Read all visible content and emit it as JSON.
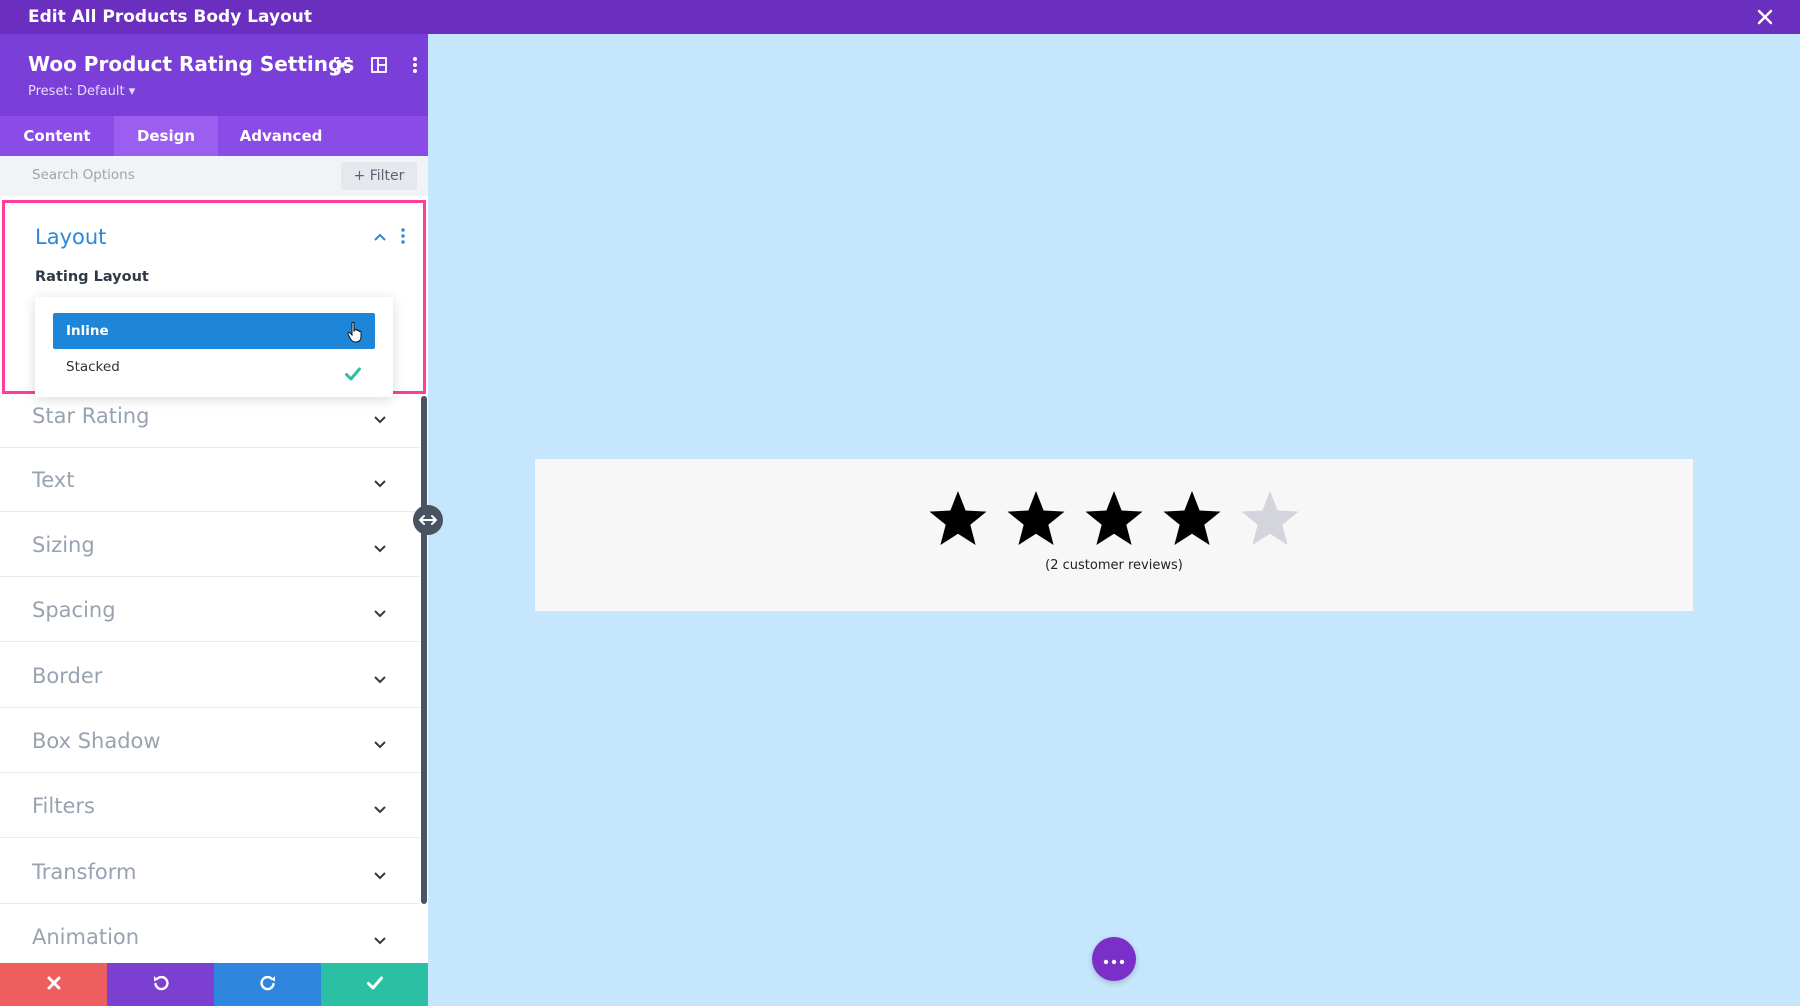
{
  "window": {
    "title": "Edit All Products Body Layout"
  },
  "panel": {
    "title": "Woo Product Rating Settings",
    "preset": "Preset: Default",
    "tabs": [
      {
        "label": "Content"
      },
      {
        "label": "Design",
        "active": true
      },
      {
        "label": "Advanced"
      }
    ],
    "search_placeholder": "Search Options",
    "filter_label": "+ Filter",
    "layout": {
      "title": "Layout",
      "field_label": "Rating Layout",
      "options": [
        {
          "label": "Inline",
          "highlighted": true
        },
        {
          "label": "Stacked",
          "checked": true
        }
      ]
    },
    "sections": [
      {
        "label": "Star Rating"
      },
      {
        "label": "Text"
      },
      {
        "label": "Sizing"
      },
      {
        "label": "Spacing"
      },
      {
        "label": "Border"
      },
      {
        "label": "Box Shadow"
      },
      {
        "label": "Filters"
      },
      {
        "label": "Transform"
      },
      {
        "label": "Animation"
      }
    ],
    "bottom_buttons": [
      {
        "name": "discard",
        "icon": "close-icon",
        "color": "#ee5e5e"
      },
      {
        "name": "undo",
        "icon": "undo-icon",
        "color": "#7b3fd1"
      },
      {
        "name": "redo",
        "icon": "redo-icon",
        "color": "#2e86de"
      },
      {
        "name": "save",
        "icon": "check-icon",
        "color": "#2bc0a3"
      }
    ]
  },
  "canvas": {
    "rating": {
      "value": 4,
      "max": 5
    },
    "reviews_text": "(2 customer reviews)"
  },
  "colors": {
    "topbar": "#6b2fbf",
    "accent_blue": "#2b87da",
    "highlight_pink": "#ff3e9a",
    "canvas_bg": "#c5e6fc"
  }
}
